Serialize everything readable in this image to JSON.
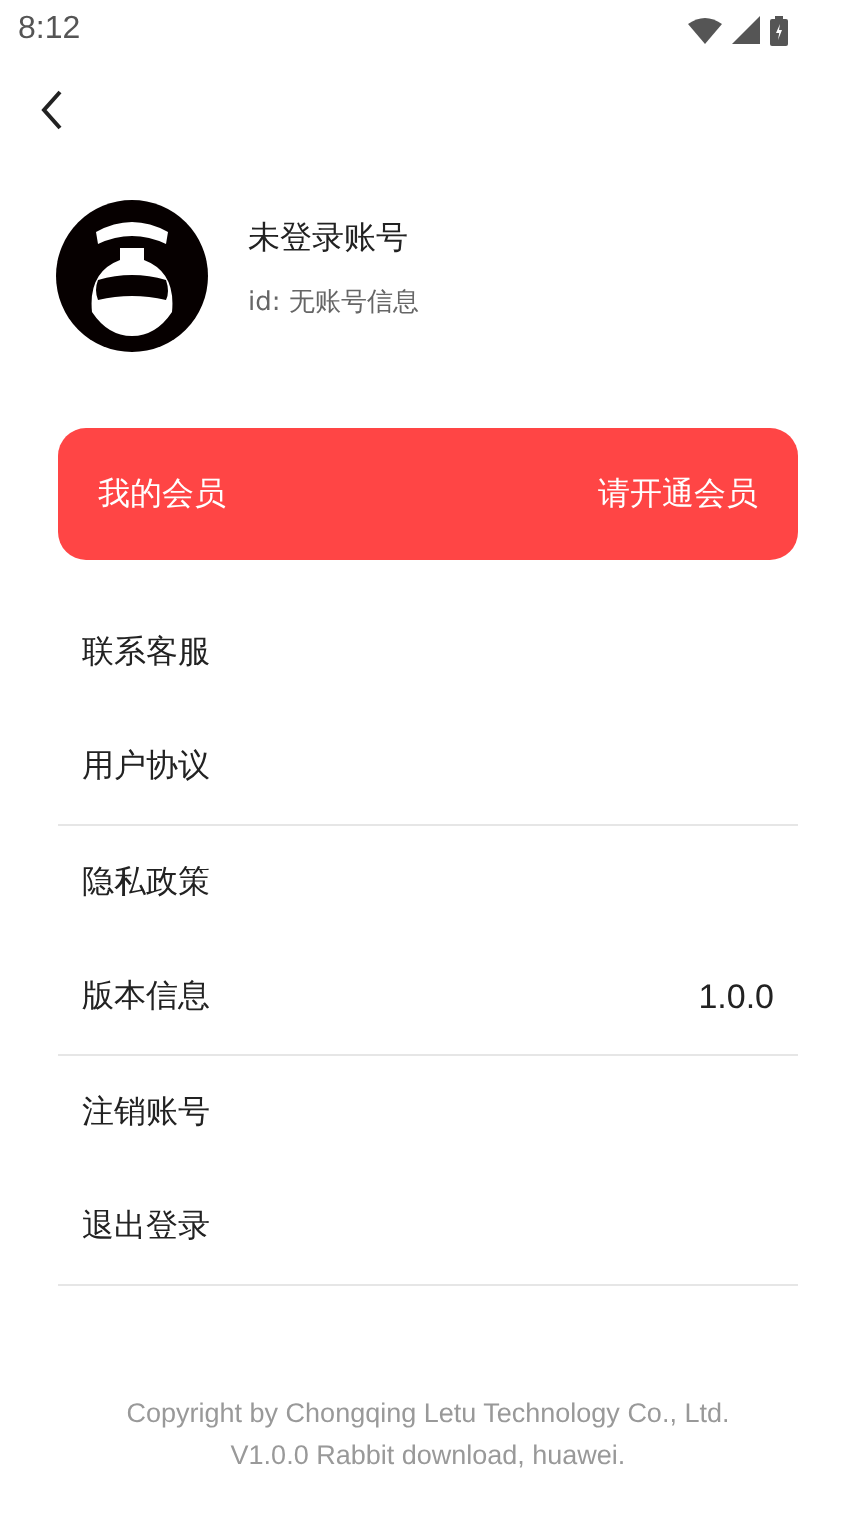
{
  "status_bar": {
    "time": "8:12"
  },
  "profile": {
    "name": "未登录账号",
    "id": "id: 无账号信息"
  },
  "membership": {
    "title": "我的会员",
    "action": "请开通会员"
  },
  "menu_groups": [
    [
      {
        "label": "联系客服"
      },
      {
        "label": "用户协议"
      }
    ],
    [
      {
        "label": "隐私政策"
      },
      {
        "label": "版本信息",
        "value": "1.0.0"
      }
    ],
    [
      {
        "label": "注销账号"
      },
      {
        "label": "退出登录"
      }
    ]
  ],
  "footer": [
    "Copyright by Chongqing Letu Technology Co., Ltd.",
    "V1.0.0 Rabbit download, huawei."
  ]
}
